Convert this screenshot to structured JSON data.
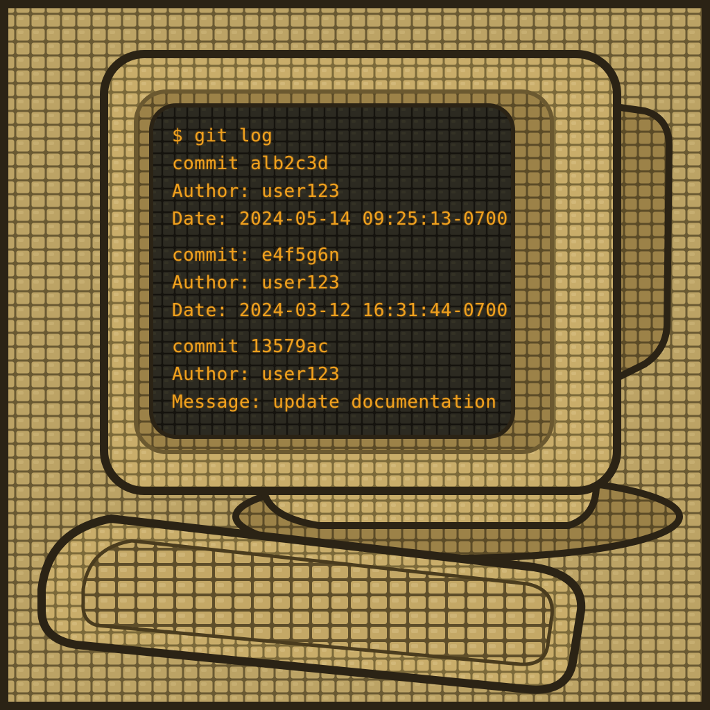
{
  "terminal": {
    "prompt": "$ git log",
    "entries": [
      {
        "commit": "commit  alb2c3d",
        "author": "Author: user123",
        "detail": "Date: 2024-05-14  09:25:13-0700"
      },
      {
        "commit": "commit: e4f5g6n",
        "author": "Author: user123",
        "detail": "Date: 2024-03-12  16:31:44-0700"
      },
      {
        "commit": "commit  13579ac",
        "author": "Author: user123",
        "detail": "Message: update documentation"
      }
    ]
  },
  "colors": {
    "background_tile": "#b39a5e",
    "border_dark": "#2b2315",
    "screen": "#27251d",
    "terminal_text": "#f0a11e",
    "monitor_body": "#c2a866",
    "monitor_shade": "#8f7a44"
  }
}
